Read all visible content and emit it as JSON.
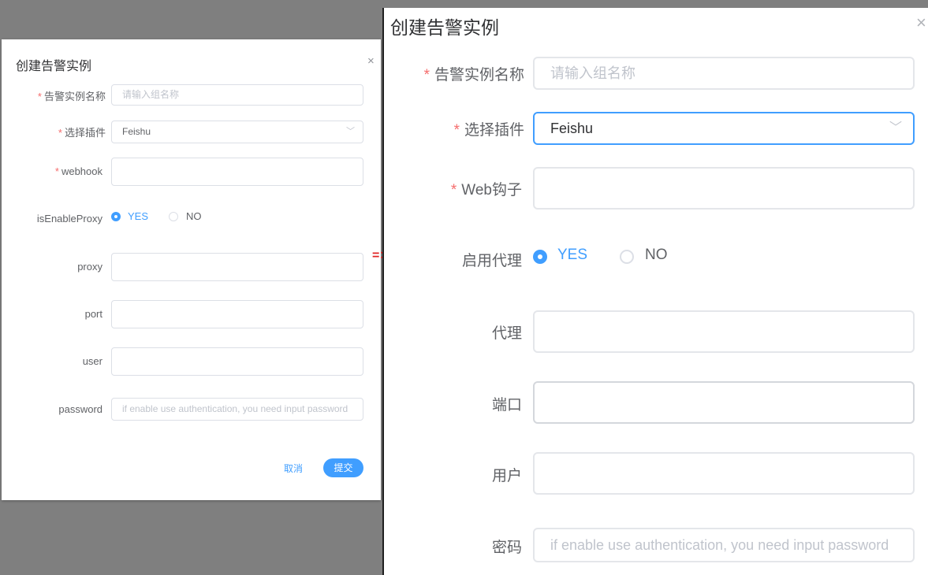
{
  "left_dialog": {
    "title": "创建告警实例",
    "close_glyph": "×",
    "required_mark": "*",
    "fields": {
      "name": {
        "label": "告警实例名称",
        "placeholder": "请输入组名称"
      },
      "plugin": {
        "label": "选择插件",
        "value": "Feishu"
      },
      "webhook": {
        "label": "webhook"
      },
      "proxy_enable": {
        "label": "isEnableProxy",
        "yes": "YES",
        "no": "NO"
      },
      "proxy": {
        "label": "proxy"
      },
      "port": {
        "label": "port"
      },
      "user": {
        "label": "user"
      },
      "password": {
        "label": "password",
        "placeholder": "if enable use authentication, you need input password"
      }
    },
    "cancel_label": "取消",
    "submit_label": "提交"
  },
  "arrow": "=>",
  "right_dialog": {
    "title": "创建告警实例",
    "close_glyph": "×",
    "required_mark": "*",
    "fields": {
      "name": {
        "label": "告警实例名称",
        "placeholder": "请输入组名称"
      },
      "plugin": {
        "label": "选择插件",
        "value": "Feishu"
      },
      "webhook": {
        "label": "Web钩子"
      },
      "proxy_enable": {
        "label": "启用代理",
        "yes": "YES",
        "no": "NO"
      },
      "proxy": {
        "label": "代理"
      },
      "port": {
        "label": "端口"
      },
      "user": {
        "label": "用户"
      },
      "password": {
        "label": "密码",
        "placeholder": "if enable use authentication, you need input password"
      }
    }
  },
  "colors": {
    "accent": "#409eff",
    "required": "#f56c6c",
    "arrow": "#e02424"
  },
  "icons": {
    "close": "close-icon",
    "dropdown": "chevron-down-icon"
  }
}
